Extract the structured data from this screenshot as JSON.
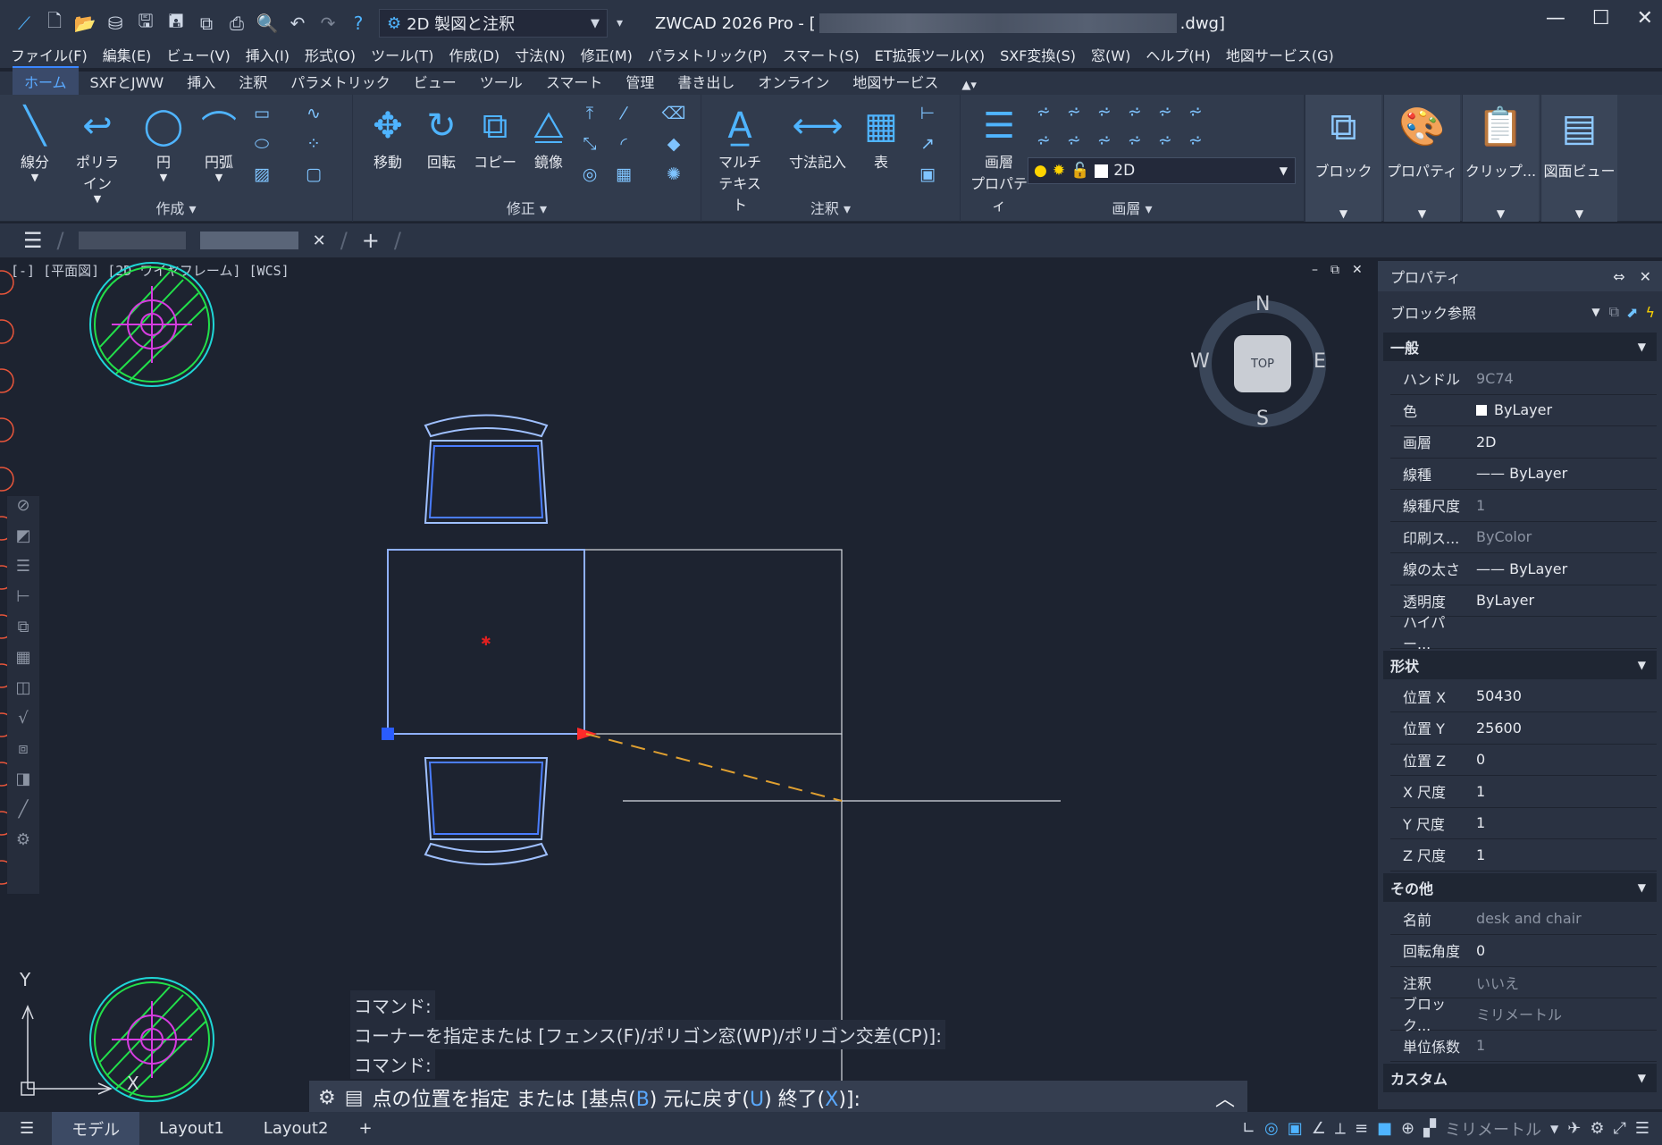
{
  "titlebar": {
    "workspace": "2D 製図と注釈",
    "app_title_prefix": "ZWCAD 2026 Pro - [",
    "app_title_suffix": ".dwg]"
  },
  "menu": [
    "ファイル(F)",
    "編集(E)",
    "ビュー(V)",
    "挿入(I)",
    "形式(O)",
    "ツール(T)",
    "作成(D)",
    "寸法(N)",
    "修正(M)",
    "パラメトリック(P)",
    "スマート(S)",
    "ET拡張ツール(X)",
    "SXF変換(S)",
    "窓(W)",
    "ヘルプ(H)",
    "地図サービス(G)"
  ],
  "ribbon_tabs": [
    "ホーム",
    "SXFとJWW",
    "挿入",
    "注釈",
    "パラメトリック",
    "ビュー",
    "ツール",
    "スマート",
    "管理",
    "書き出し",
    "オンライン",
    "地図サービス"
  ],
  "ribbon": {
    "create": {
      "title": "作成",
      "line": "線分",
      "polyline": "ポリライン",
      "circle": "円",
      "arc": "円弧"
    },
    "modify": {
      "title": "修正",
      "move": "移動",
      "rotate": "回転",
      "copy": "コピー",
      "mirror": "鏡像"
    },
    "annotate": {
      "title": "注釈",
      "mtext_1": "マルチ",
      "mtext_2": "テキスト",
      "dim": "寸法記入",
      "table": "表"
    },
    "layers": {
      "title": "画層",
      "props_1": "画層",
      "props_2": "プロパティ",
      "current": "2D"
    },
    "block": "ブロック",
    "properties": "プロパティ",
    "clipboard": "クリップ...",
    "viewport": "図面ビュー"
  },
  "viewport_label": "[-] [平面図] [2D ワイヤフレーム] [WCS]",
  "viewcube": {
    "n": "N",
    "s": "S",
    "e": "E",
    "w": "W",
    "top": "TOP"
  },
  "ucs": {
    "x": "X",
    "y": "Y"
  },
  "command_history": [
    "コマンド:",
    "コーナーを指定または [フェンス(F)/ポリゴン窓(WP)/ポリゴン交差(CP)]:",
    "コマンド:"
  ],
  "command_prompt": {
    "p1": "点の位置を指定 または [基点(",
    "o1": "B",
    "p2": ") 元に戻す(",
    "o2": "U",
    "p3": ") 終了(",
    "o3": "X",
    "p4": ")]:"
  },
  "properties_panel": {
    "title": "プロパティ",
    "selection": "ブロック参照",
    "general_title": "一般",
    "general": [
      {
        "k": "ハンドル",
        "v": "9C74",
        "dim": true
      },
      {
        "k": "色",
        "v": "ByLayer"
      },
      {
        "k": "画層",
        "v": "2D"
      },
      {
        "k": "線種",
        "v": "—— ByLayer"
      },
      {
        "k": "線種尺度",
        "v": "1",
        "dim": true
      },
      {
        "k": "印刷ス...",
        "v": "ByColor",
        "dim": true
      },
      {
        "k": "線の太さ",
        "v": "—— ByLayer"
      },
      {
        "k": "透明度",
        "v": "ByLayer"
      },
      {
        "k": "ハイパー...",
        "v": ""
      }
    ],
    "geometry_title": "形状",
    "geometry": [
      {
        "k": "位置 X",
        "v": "50430"
      },
      {
        "k": "位置 Y",
        "v": "25600"
      },
      {
        "k": "位置 Z",
        "v": "0"
      },
      {
        "k": "X 尺度",
        "v": "1"
      },
      {
        "k": "Y 尺度",
        "v": "1"
      },
      {
        "k": "Z 尺度",
        "v": "1"
      }
    ],
    "misc_title": "その他",
    "misc": [
      {
        "k": "名前",
        "v": "desk and chair",
        "dim": true
      },
      {
        "k": "回転角度",
        "v": "0"
      },
      {
        "k": "注釈",
        "v": "いいえ",
        "dim": true
      },
      {
        "k": "ブロック...",
        "v": "ミリメートル",
        "dim": true
      },
      {
        "k": "単位係数",
        "v": "1",
        "dim": true
      }
    ],
    "custom_title": "カスタム"
  },
  "status": {
    "model": "モデル",
    "layout1": "Layout1",
    "layout2": "Layout2",
    "units": "ミリメートル"
  },
  "colors": {
    "accent": "#3a86ff",
    "canvas": "#1d2330",
    "block_outline": "#4a7dff"
  }
}
